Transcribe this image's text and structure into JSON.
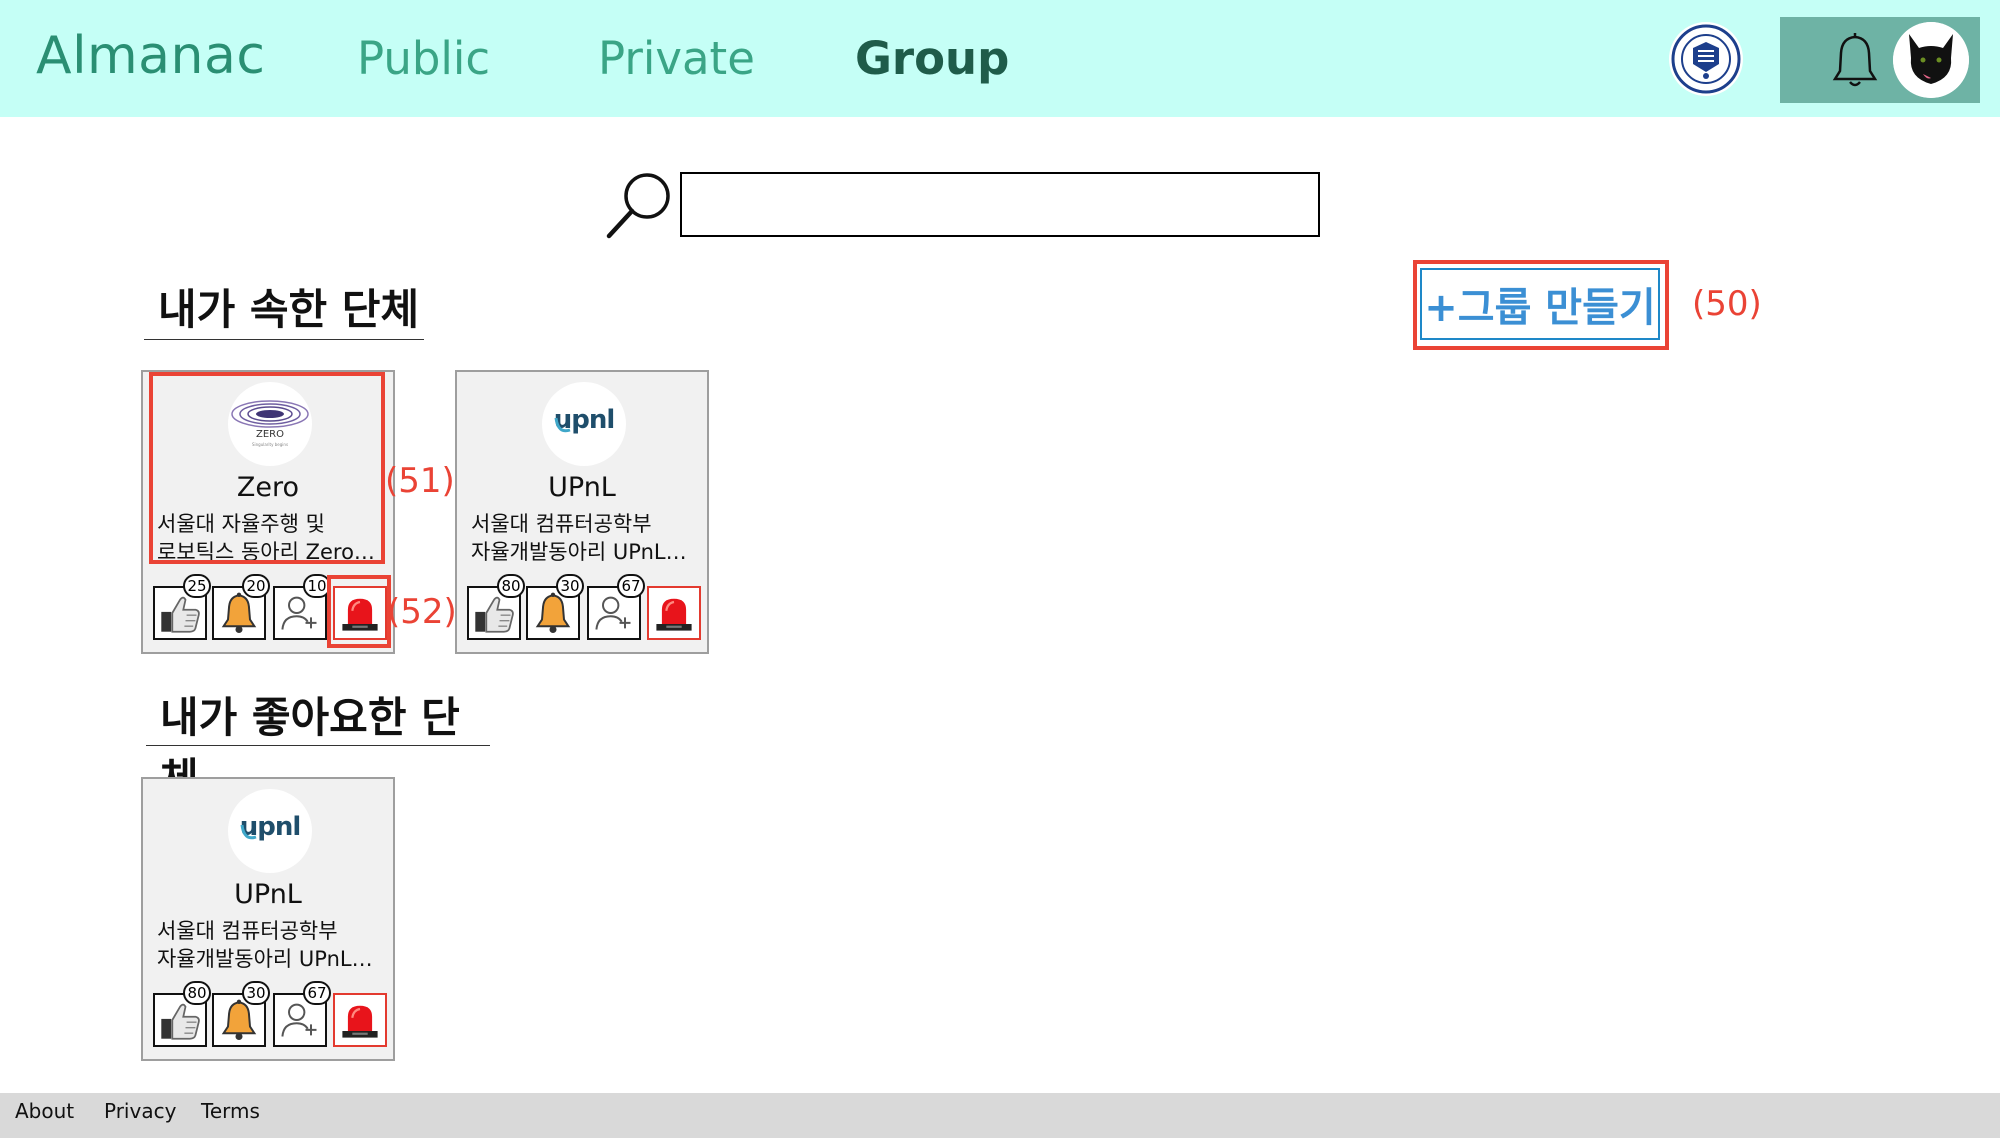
{
  "header": {
    "brand": "Almanac",
    "nav": {
      "public": "Public",
      "private": "Private",
      "group": "Group"
    },
    "active_tab": "Group",
    "univ_logo_icon": "university-seal-icon",
    "notification_icon": "bell-icon",
    "avatar_icon": "black-cat-avatar"
  },
  "search": {
    "placeholder": "",
    "value": ""
  },
  "create_group": {
    "label": "+그룹 만들기",
    "annotation": "(50)"
  },
  "sections": {
    "mine": "내가 속한 단체",
    "liked": "내가 좋아요한 단체"
  },
  "my_groups": [
    {
      "name": "Zero",
      "logo_text": "ZERO",
      "logo_subtext": "Singularity begins",
      "desc_line1": "서울대 자율주행 및",
      "desc_line2": "로보틱스 동아리 Zero…",
      "likes": "25",
      "notices": "20",
      "members": "10",
      "annotation_card": "(51)",
      "annotation_alarm": "(52)"
    },
    {
      "name": "UPnL",
      "logo_text": "upnl",
      "desc_line1": "서울대 컴퓨터공학부",
      "desc_line2": "자율개발동아리 UPnL…",
      "likes": "80",
      "notices": "30",
      "members": "67"
    }
  ],
  "liked_groups": [
    {
      "name": "UPnL",
      "logo_text": "upnl",
      "desc_line1": "서울대 컴퓨터공학부",
      "desc_line2": "자율개발동아리 UPnL…",
      "likes": "80",
      "notices": "30",
      "members": "67"
    }
  ],
  "footer": {
    "about": "About",
    "privacy": "Privacy",
    "terms": "Terms"
  },
  "colors": {
    "header_bg": "#c5fff6",
    "brand": "#2a8f73",
    "nav": "#3aa586",
    "nav_active": "#1f5c4a",
    "user_panel": "#6eb3a5",
    "create_text": "#3b8fd4",
    "annotation_red": "#ea4335",
    "card_bg": "#f1f1f1",
    "footer_bg": "#d9d9d9"
  }
}
